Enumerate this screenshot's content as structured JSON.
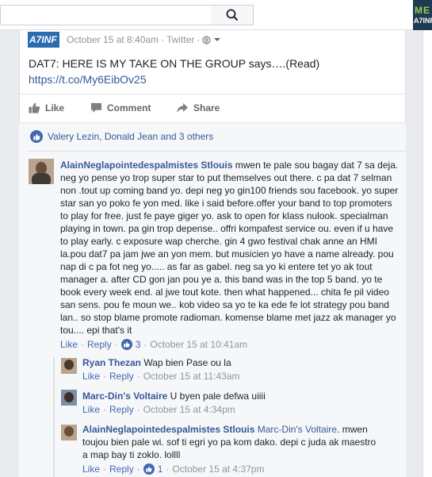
{
  "post": {
    "page_logo_text": "A7INF",
    "timestamp": "October 15 at 8:40am",
    "separator": "·",
    "source": "Twitter",
    "text": "DAT7: HERE IS MY TAKE ON THE GROUP says….(Read)",
    "link": "https://t.co/My6EibOv25"
  },
  "sidebar_thumb": {
    "line1": "ME",
    "line2": "A7INF"
  },
  "actions": {
    "like": "Like",
    "comment": "Comment",
    "share": "Share"
  },
  "likes_summary": "Valery Lezin, Donald Jean and 3 others",
  "comments": [
    {
      "author": "AlainNeglapointedespalmistes Stlouis",
      "text": "mwen te pale sou bagay dat 7 sa deja. neg yo pense yo trop super star to put themselves out there. c pa dat 7 selman non .tout up coming band yo. depi neg yo gin100 friends sou facebook. yo super star san yo poko fe yon med. like i said before.offer your band to top promoters to play for free. just fe paye giger yo. ask to open for klass nulook. specialman playing in town. pa gin trop depense.. offri kompafest service ou. even if u have to play early. c exposure wap cherche. gin 4 gwo festival chak anne an HMI la.pou dat7 pa jam jwe an yon mem. but musicien yo have a name already. pou nap di c pa fot neg yo..... as far as gabel. neg sa yo ki entere tet yo ak tout manager a. after CD gon jan pou ye a. this band was in the top 5 band. yo te book every week end. al jwe tout kote. then what happened... chita fe pil video san sens. pou fe moun we.. kob video sa yo te ka ede fe lot strategy pou band lan.. so stop blame promote radioman. komense blame met jazz ak manager yo tou.... epi that's it",
      "like": "Like",
      "reply": "Reply",
      "reactions": "3",
      "time": "October 15 at 10:41am"
    }
  ],
  "replies": [
    {
      "author": "Ryan Thezan",
      "text": "Wap bien Pase ou la",
      "like": "Like",
      "reply": "Reply",
      "time": "October 15 at 11:43am"
    },
    {
      "author": "Marc-Din's Voltaire",
      "text": "U byen pale defwa uiiii",
      "like": "Like",
      "reply": "Reply",
      "time": "October 15 at 4:34pm"
    },
    {
      "author": "AlainNeglapointedespalmistes Stlouis",
      "mention": "Marc-Din's Voltaire",
      "text": ". mwen toujou bien pale wi. sof ti egri yo pa kom dako. depi c juda ak maestro a map bay ti zoklo. lollll",
      "like": "Like",
      "reply": "Reply",
      "reactions": "1",
      "time": "October 15 at 4:37pm"
    }
  ],
  "meta_separator": "·",
  "icons": [
    "search-icon",
    "globe-icon",
    "chevron-down-icon",
    "like-icon",
    "comment-icon",
    "share-icon",
    "like-badge-icon"
  ],
  "colors": {
    "link": "#365899",
    "meta": "#90949c",
    "accent": "#4267b2",
    "background": "#e9ebee"
  }
}
